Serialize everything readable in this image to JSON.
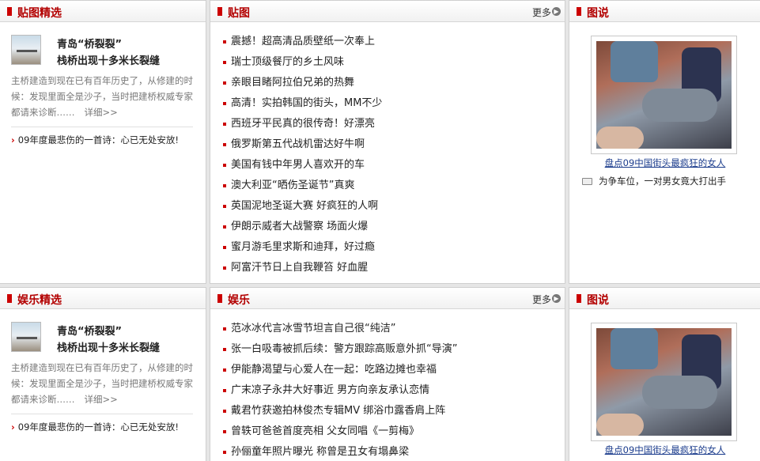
{
  "top": {
    "left": {
      "title": "贴图精选",
      "feature": {
        "title1": "青岛“桥裂裂”",
        "title2": "栈桥出现十多米长裂缝",
        "desc": "主桥建造到现在已有百年历史了，从修建的时候：发现里面全是沙子，当时把建桥权威专家都请来诊断……",
        "detail": "详细>>"
      },
      "link": "09年度最悲伤的一首诗：心已无处安放!"
    },
    "middle": {
      "title": "贴图",
      "more": "更多",
      "items": [
        "震撼！超高清品质壁纸一次奉上",
        "瑞士顶级餐厅的乡土风味",
        "亲眼目睹阿拉伯兄弟的热舞",
        "高清！实拍韩国的街头，MM不少",
        "西班牙平民真的很传奇！好漂亮",
        "俄罗斯第五代战机雷达好牛啊",
        "美国有钱中年男人喜欢开的车",
        "澳大利亚“晒伤圣诞节”真爽",
        "英国泥地圣诞大赛 好疯狂的人啊",
        "伊朗示威者大战警察 场面火爆",
        "蜜月游毛里求斯和迪拜，好过瘾",
        "阿富汗节日上自我鞭笞 好血腥"
      ]
    },
    "right": {
      "title": "图说",
      "caption": "盘点09中国街头最疯狂的女人",
      "link": "为争车位，一对男女竟大打出手"
    }
  },
  "bottom": {
    "left": {
      "title": "娱乐精选",
      "feature": {
        "title1": "青岛“桥裂裂”",
        "title2": "栈桥出现十多米长裂缝",
        "desc": "主桥建造到现在已有百年历史了，从修建的时候：发现里面全是沙子，当时把建桥权威专家都请来诊断……",
        "detail": "详细>>"
      },
      "link": "09年度最悲伤的一首诗：心已无处安放!"
    },
    "middle": {
      "title": "娱乐",
      "more": "更多",
      "items": [
        "范冰冰代言冰雪节坦言自己很“纯洁”",
        "张一白吸毒被抓后续：警方跟踪高贩意外抓“导演”",
        "伊能静渴望与心爱人在一起：吃路边摊也幸福",
        "广末凉子永井大好事近 男方向亲友承认恋情",
        "戴君竹获邀拍林俊杰专辑MV 绑浴巾露香肩上阵",
        "曾轶可爸爸首度亮相 父女同唱《一剪梅》",
        "孙俪童年照片曝光 称曾是丑女有塌鼻梁"
      ]
    },
    "right": {
      "title": "图说",
      "caption": "盘点09中国街头最疯狂的女人"
    }
  }
}
